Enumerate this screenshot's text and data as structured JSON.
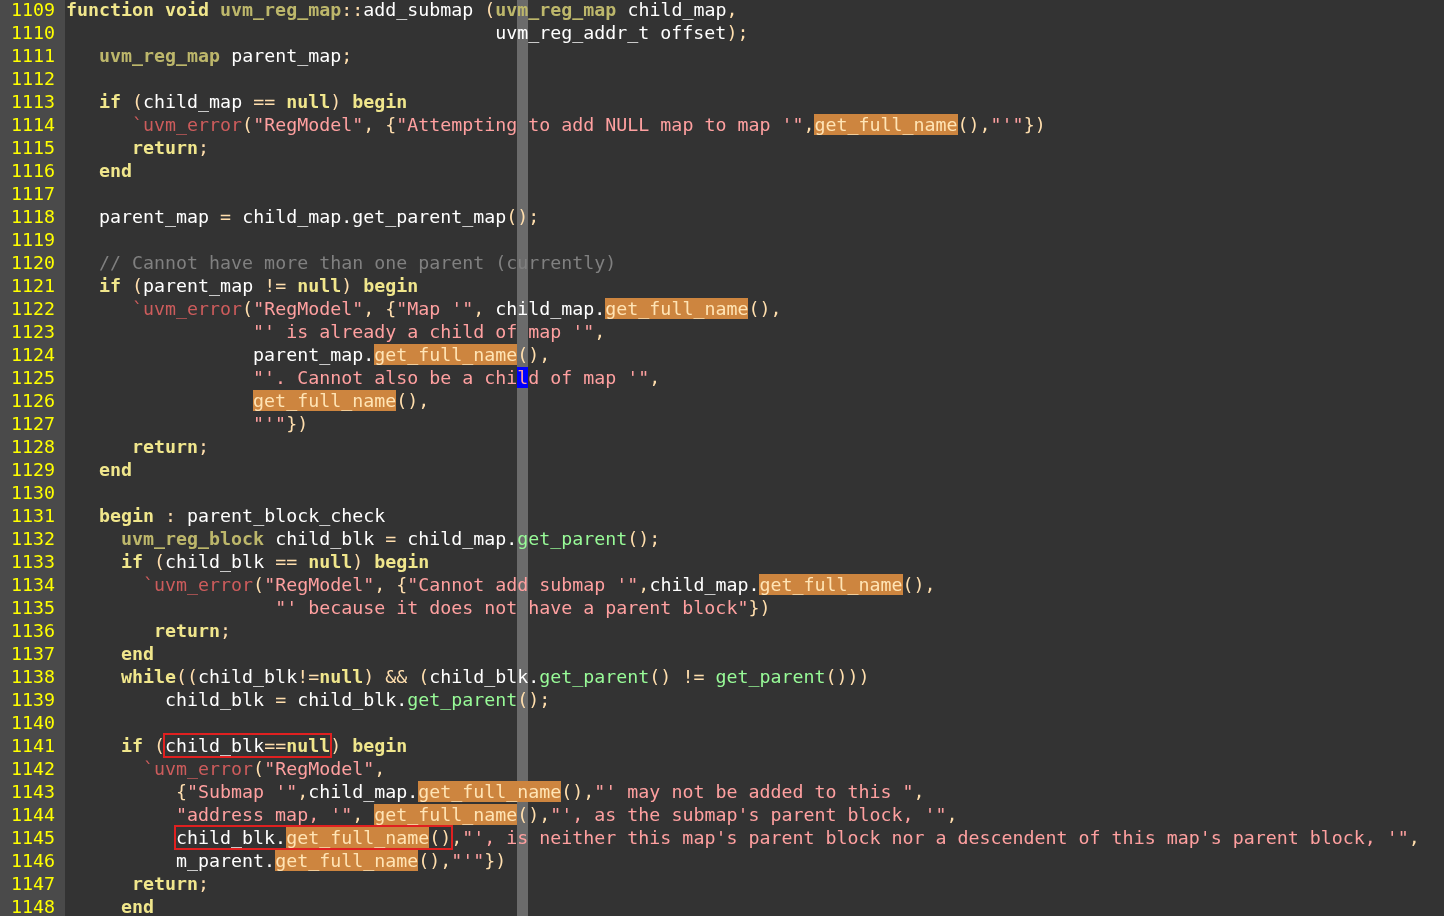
{
  "editor": {
    "lines": [
      {
        "number": "1109",
        "tokens": [
          {
            "kind": "keyword",
            "text": "function void "
          },
          {
            "kind": "type",
            "text": "uvm_reg_map"
          },
          {
            "kind": "punct",
            "text": "::"
          },
          {
            "kind": "plain",
            "text": "add_submap "
          },
          {
            "kind": "punct",
            "text": "("
          },
          {
            "kind": "type",
            "text": "uvm_reg_map"
          },
          {
            "kind": "plain",
            "text": " child_map"
          },
          {
            "kind": "punct",
            "text": ","
          }
        ]
      },
      {
        "number": "1110",
        "tokens": [
          {
            "kind": "plain",
            "text": "                                       uvm_reg_addr_t offset"
          },
          {
            "kind": "punct",
            "text": ");"
          }
        ]
      },
      {
        "number": "1111",
        "tokens": [
          {
            "kind": "type",
            "text": "   uvm_reg_map"
          },
          {
            "kind": "plain",
            "text": " parent_map"
          },
          {
            "kind": "punct",
            "text": ";"
          }
        ]
      },
      {
        "number": "1112"
      },
      {
        "number": "1113",
        "tokens": [
          {
            "kind": "keyword",
            "text": "   if "
          },
          {
            "kind": "punct",
            "text": "("
          },
          {
            "kind": "plain",
            "text": "child_map "
          },
          {
            "kind": "punct",
            "text": "== "
          },
          {
            "kind": "keyword",
            "text": "null"
          },
          {
            "kind": "punct",
            "text": ") "
          },
          {
            "kind": "keyword",
            "text": "begin"
          }
        ]
      },
      {
        "number": "1114",
        "tokens": [
          {
            "kind": "macro",
            "text": "      `uvm_error"
          },
          {
            "kind": "punct",
            "text": "("
          },
          {
            "kind": "string",
            "text": "\"RegModel\""
          },
          {
            "kind": "punct",
            "text": ", {"
          },
          {
            "kind": "string",
            "text": "\"Attempting to add NULL map to map '\""
          },
          {
            "kind": "punct",
            "text": ","
          },
          {
            "kind": "highlight",
            "text": "get_full_name"
          },
          {
            "kind": "punct",
            "text": "(),"
          },
          {
            "kind": "string",
            "text": "\"'\""
          },
          {
            "kind": "punct",
            "text": "})"
          }
        ]
      },
      {
        "number": "1115",
        "tokens": [
          {
            "kind": "keyword",
            "text": "      return"
          },
          {
            "kind": "punct",
            "text": ";"
          }
        ]
      },
      {
        "number": "1116",
        "tokens": [
          {
            "kind": "keyword",
            "text": "   end"
          }
        ]
      },
      {
        "number": "1117"
      },
      {
        "number": "1118",
        "tokens": [
          {
            "kind": "plain",
            "text": "   parent_map "
          },
          {
            "kind": "punct",
            "text": "= "
          },
          {
            "kind": "plain",
            "text": "child_map.get_parent_map"
          },
          {
            "kind": "punct",
            "text": "();"
          }
        ]
      },
      {
        "number": "1119"
      },
      {
        "number": "1120",
        "tokens": [
          {
            "kind": "comment",
            "text": "   // Cannot have more than one parent (currently)"
          }
        ]
      },
      {
        "number": "1121",
        "tokens": [
          {
            "kind": "keyword",
            "text": "   if "
          },
          {
            "kind": "punct",
            "text": "("
          },
          {
            "kind": "plain",
            "text": "parent_map "
          },
          {
            "kind": "punct",
            "text": "!= "
          },
          {
            "kind": "keyword",
            "text": "null"
          },
          {
            "kind": "punct",
            "text": ") "
          },
          {
            "kind": "keyword",
            "text": "begin"
          }
        ]
      },
      {
        "number": "1122",
        "tokens": [
          {
            "kind": "macro",
            "text": "      `uvm_error"
          },
          {
            "kind": "punct",
            "text": "("
          },
          {
            "kind": "string",
            "text": "\"RegModel\""
          },
          {
            "kind": "punct",
            "text": ", {"
          },
          {
            "kind": "string",
            "text": "\"Map '\""
          },
          {
            "kind": "punct",
            "text": ", "
          },
          {
            "kind": "plain",
            "text": "child_map."
          },
          {
            "kind": "highlight",
            "text": "get_full_name"
          },
          {
            "kind": "punct",
            "text": "(),"
          }
        ]
      },
      {
        "number": "1123",
        "tokens": [
          {
            "kind": "string",
            "text": "                 \"' is already a child of map '\""
          },
          {
            "kind": "punct",
            "text": ","
          }
        ]
      },
      {
        "number": "1124",
        "tokens": [
          {
            "kind": "plain",
            "text": "                 parent_map."
          },
          {
            "kind": "highlight",
            "text": "get_full_name"
          },
          {
            "kind": "punct",
            "text": "(),"
          }
        ]
      },
      {
        "number": "1125",
        "tokens": [
          {
            "kind": "string",
            "text": "                 \"'. Cannot also be a chi"
          },
          {
            "kind": "cursor",
            "text": "l"
          },
          {
            "kind": "string",
            "text": "d of map '\""
          },
          {
            "kind": "punct",
            "text": ","
          }
        ]
      },
      {
        "number": "1126",
        "tokens": [
          {
            "kind": "highlight",
            "text": "                 get_full_name"
          },
          {
            "kind": "punct",
            "text": "(),"
          }
        ]
      },
      {
        "number": "1127",
        "tokens": [
          {
            "kind": "string",
            "text": "                 \"'\""
          },
          {
            "kind": "punct",
            "text": "})"
          }
        ]
      },
      {
        "number": "1128",
        "tokens": [
          {
            "kind": "keyword",
            "text": "      return"
          },
          {
            "kind": "punct",
            "text": ";"
          }
        ]
      },
      {
        "number": "1129",
        "tokens": [
          {
            "kind": "keyword",
            "text": "   end"
          }
        ]
      },
      {
        "number": "1130"
      },
      {
        "number": "1131",
        "tokens": [
          {
            "kind": "keyword",
            "text": "   begin"
          },
          {
            "kind": "punct",
            "text": " : "
          },
          {
            "kind": "plain",
            "text": "parent_block_check"
          }
        ]
      },
      {
        "number": "1132",
        "tokens": [
          {
            "kind": "type",
            "text": "     uvm_reg_block"
          },
          {
            "kind": "plain",
            "text": " child_blk "
          },
          {
            "kind": "punct",
            "text": "= "
          },
          {
            "kind": "plain",
            "text": "child_map."
          },
          {
            "kind": "call",
            "text": "get_parent"
          },
          {
            "kind": "punct",
            "text": "();"
          }
        ]
      },
      {
        "number": "1133",
        "tokens": [
          {
            "kind": "keyword",
            "text": "     if "
          },
          {
            "kind": "punct",
            "text": "("
          },
          {
            "kind": "plain",
            "text": "child_blk "
          },
          {
            "kind": "punct",
            "text": "== "
          },
          {
            "kind": "keyword",
            "text": "null"
          },
          {
            "kind": "punct",
            "text": ") "
          },
          {
            "kind": "keyword",
            "text": "begin"
          }
        ]
      },
      {
        "number": "1134",
        "tokens": [
          {
            "kind": "macro",
            "text": "       `uvm_error"
          },
          {
            "kind": "punct",
            "text": "("
          },
          {
            "kind": "string",
            "text": "\"RegModel\""
          },
          {
            "kind": "punct",
            "text": ", {"
          },
          {
            "kind": "string",
            "text": "\"Cannot add submap '\""
          },
          {
            "kind": "punct",
            "text": ","
          },
          {
            "kind": "plain",
            "text": "child_map."
          },
          {
            "kind": "highlight",
            "text": "get_full_name"
          },
          {
            "kind": "punct",
            "text": "(),"
          }
        ]
      },
      {
        "number": "1135",
        "tokens": [
          {
            "kind": "string",
            "text": "                   \"' because it does not have a parent block\""
          },
          {
            "kind": "punct",
            "text": "})"
          }
        ]
      },
      {
        "number": "1136",
        "tokens": [
          {
            "kind": "keyword",
            "text": "        return"
          },
          {
            "kind": "punct",
            "text": ";"
          }
        ]
      },
      {
        "number": "1137",
        "tokens": [
          {
            "kind": "keyword",
            "text": "     end"
          }
        ]
      },
      {
        "number": "1138",
        "tokens": [
          {
            "kind": "keyword",
            "text": "     while"
          },
          {
            "kind": "punct",
            "text": "(("
          },
          {
            "kind": "plain",
            "text": "child_blk"
          },
          {
            "kind": "punct",
            "text": "!="
          },
          {
            "kind": "keyword",
            "text": "null"
          },
          {
            "kind": "punct",
            "text": ") && ("
          },
          {
            "kind": "plain",
            "text": "child_blk."
          },
          {
            "kind": "call",
            "text": "get_parent"
          },
          {
            "kind": "punct",
            "text": "() != "
          },
          {
            "kind": "call",
            "text": "get_parent"
          },
          {
            "kind": "punct",
            "text": "()))"
          }
        ]
      },
      {
        "number": "1139",
        "tokens": [
          {
            "kind": "plain",
            "text": "         child_blk "
          },
          {
            "kind": "punct",
            "text": "= "
          },
          {
            "kind": "plain",
            "text": "child_blk."
          },
          {
            "kind": "call",
            "text": "get_parent"
          },
          {
            "kind": "punct",
            "text": "();"
          }
        ]
      },
      {
        "number": "1140"
      },
      {
        "number": "1141",
        "tokens": [
          {
            "kind": "keyword",
            "text": "     if "
          },
          {
            "kind": "punct",
            "text": "("
          },
          {
            "kind": "box",
            "tokens": [
              {
                "kind": "plain",
                "text": "child_blk"
              },
              {
                "kind": "punct",
                "text": "=="
              },
              {
                "kind": "keyword",
                "text": "null"
              }
            ]
          },
          {
            "kind": "punct",
            "text": ") "
          },
          {
            "kind": "keyword",
            "text": "begin"
          }
        ]
      },
      {
        "number": "1142",
        "tokens": [
          {
            "kind": "macro",
            "text": "       `uvm_error"
          },
          {
            "kind": "punct",
            "text": "("
          },
          {
            "kind": "string",
            "text": "\"RegModel\""
          },
          {
            "kind": "punct",
            "text": ","
          }
        ]
      },
      {
        "number": "1143",
        "tokens": [
          {
            "kind": "punct",
            "text": "          {"
          },
          {
            "kind": "string",
            "text": "\"Submap '\""
          },
          {
            "kind": "punct",
            "text": ","
          },
          {
            "kind": "plain",
            "text": "child_map."
          },
          {
            "kind": "highlight",
            "text": "get_full_name"
          },
          {
            "kind": "punct",
            "text": "(),"
          },
          {
            "kind": "string",
            "text": "\"' may not be added to this \""
          },
          {
            "kind": "punct",
            "text": ","
          }
        ]
      },
      {
        "number": "1144",
        "tokens": [
          {
            "kind": "string",
            "text": "          \"address map, '\""
          },
          {
            "kind": "punct",
            "text": ", "
          },
          {
            "kind": "highlight",
            "text": "get_full_name"
          },
          {
            "kind": "punct",
            "text": "(),"
          },
          {
            "kind": "string",
            "text": "\"', as the submap's parent block, '\""
          },
          {
            "kind": "punct",
            "text": ","
          }
        ]
      },
      {
        "number": "1145",
        "tokens": [
          {
            "kind": "box",
            "tokens": [
              {
                "kind": "plain",
                "text": "          child_blk."
              },
              {
                "kind": "highlight",
                "text": "get_full_name"
              },
              {
                "kind": "punct",
                "text": "()"
              }
            ]
          },
          {
            "kind": "punct",
            "text": ","
          },
          {
            "kind": "string",
            "text": "\"', is neither this map's parent block nor a descendent of this map's parent block, '\""
          },
          {
            "kind": "punct",
            "text": ","
          }
        ]
      },
      {
        "number": "1146",
        "tokens": [
          {
            "kind": "plain",
            "text": "          m_parent."
          },
          {
            "kind": "highlight",
            "text": "get_full_name"
          },
          {
            "kind": "punct",
            "text": "(),"
          },
          {
            "kind": "string",
            "text": "\"'\""
          },
          {
            "kind": "punct",
            "text": "})"
          }
        ]
      },
      {
        "number": "1147",
        "tokens": [
          {
            "kind": "keyword",
            "text": "      return"
          },
          {
            "kind": "punct",
            "text": ";"
          }
        ]
      },
      {
        "number": "1148",
        "tokens": [
          {
            "kind": "keyword",
            "text": "     end"
          }
        ]
      }
    ]
  }
}
